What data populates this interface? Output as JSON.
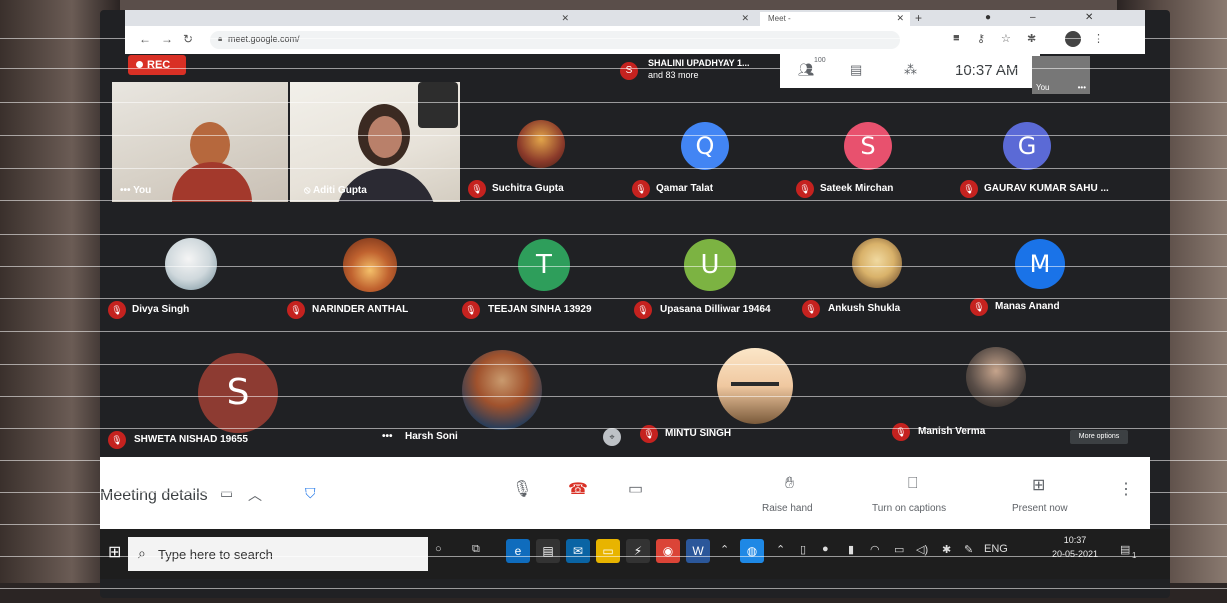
{
  "browser": {
    "tabs": [
      {
        "label": "",
        "active": false
      },
      {
        "label": "",
        "active": false
      },
      {
        "label": "Meet - ",
        "active": true
      }
    ],
    "url": "meet.google.com/"
  },
  "meet": {
    "rec_label": "REC",
    "presenter": {
      "initial": "S",
      "name": "SHALINI UPADHYAY 1...",
      "more": "and 83 more"
    },
    "topbar": {
      "people_count": "100",
      "time": "10:37 AM"
    },
    "self_thumb_label": "You",
    "more_options_tooltip": "More options",
    "participants": [
      {
        "name": "You",
        "kind": "video"
      },
      {
        "name": "Aditi Gupta",
        "kind": "video"
      },
      {
        "name": "Suchitra Gupta",
        "kind": "photo",
        "color": "#8b3a2a"
      },
      {
        "name": "Qamar Talat",
        "kind": "initial",
        "initial": "Q",
        "color": "#4285f4"
      },
      {
        "name": "Sateek Mirchan",
        "kind": "initial",
        "initial": "S",
        "color": "#e8516e"
      },
      {
        "name": "GAURAV KUMAR SAHU ...",
        "kind": "initial",
        "initial": "G",
        "color": "#5b6ad6"
      },
      {
        "name": "Divya Singh",
        "kind": "photo",
        "color": "#cfd8dc"
      },
      {
        "name": "NARINDER ANTHAL",
        "kind": "photo",
        "color": "#c0622f"
      },
      {
        "name": "TEEJAN SINHA 13929",
        "kind": "initial",
        "initial": "T",
        "color": "#2e9e5b"
      },
      {
        "name": "Upasana Dilliwar 19464",
        "kind": "initial",
        "initial": "U",
        "color": "#7cb342"
      },
      {
        "name": "Ankush Shukla",
        "kind": "photo",
        "color": "#d9b26a"
      },
      {
        "name": "Manas Anand",
        "kind": "initial",
        "initial": "M",
        "color": "#1a73e8"
      },
      {
        "name": "SHWETA NISHAD 19655",
        "kind": "initial",
        "initial": "S",
        "color": "#8d3b32"
      },
      {
        "name": "Harsh Soni",
        "kind": "photo",
        "color": "#a0522d"
      },
      {
        "name": "MINTU SINGH",
        "kind": "photo",
        "color": "#f0c8a0"
      },
      {
        "name": "Manish Verma",
        "kind": "photo",
        "color": "#5a4e48"
      }
    ],
    "controls": {
      "meeting_details": "Meeting details",
      "raise_hand": "Raise hand",
      "captions": "Turn on captions",
      "present": "Present now"
    }
  },
  "taskbar": {
    "search_placeholder": "Type here to search",
    "lang": "ENG",
    "time": "10:37",
    "date": "20-05-2021",
    "notif_count": "1"
  },
  "colors": {
    "meet_bg": "#202124",
    "rec_red": "#d93025",
    "mic_off_red": "#c5221f"
  }
}
